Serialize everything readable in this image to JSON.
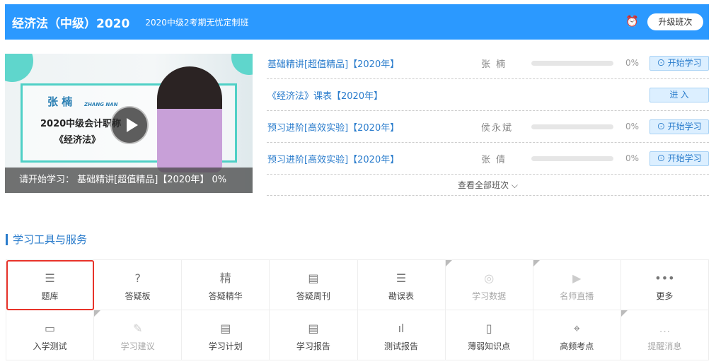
{
  "header": {
    "title": "经济法（中级）2020",
    "subtitle": "2020中级2考期无忧定制班",
    "upgrade_label": "升级班次",
    "alarm_icon": "alarm-clock-icon"
  },
  "video": {
    "teacher_name": "张  楠",
    "teacher_name_en": "ZHANG NAN",
    "line1": "2020中级会计职称",
    "line2": "《经济法》",
    "status": "请开始学习： 基础精讲[超值精品]【2020年】 0%"
  },
  "courses": [
    {
      "title": "基础精讲[超值精品]【2020年】",
      "teacher": "张  楠",
      "progress": 0,
      "pct": "0%",
      "button": "开始学习"
    },
    {
      "title": "《经济法》课表【2020年】",
      "button": "进 入"
    },
    {
      "title": "预习进阶[高效实验]【2020年】",
      "teacher": "侯永斌",
      "progress": 0,
      "pct": "0%",
      "button": "开始学习"
    },
    {
      "title": "预习进阶[高效实验]【2020年】",
      "teacher": "张  倩",
      "progress": 0,
      "pct": "0%",
      "button": "开始学习"
    }
  ],
  "more_label": "查看全部班次 ⌵",
  "tools": {
    "title": "学习工具与服务",
    "items": [
      {
        "label": "题库",
        "icon": "☰"
      },
      {
        "label": "答疑板",
        "icon": "?"
      },
      {
        "label": "答疑精华",
        "icon": "精"
      },
      {
        "label": "答疑周刊",
        "icon": "▤"
      },
      {
        "label": "勘误表",
        "icon": "☰"
      },
      {
        "label": "学习数据",
        "icon": "◎"
      },
      {
        "label": "名师直播",
        "icon": "▶"
      },
      {
        "label": "更多",
        "icon": "•••"
      },
      {
        "label": "入学测试",
        "icon": "▭"
      },
      {
        "label": "学习建议",
        "icon": "✎"
      },
      {
        "label": "学习计划",
        "icon": "▤"
      },
      {
        "label": "学习报告",
        "icon": "▤"
      },
      {
        "label": "测试报告",
        "icon": "ıl"
      },
      {
        "label": "薄弱知识点",
        "icon": "▯"
      },
      {
        "label": "高频考点",
        "icon": "⌖"
      },
      {
        "label": "提醒消息",
        "icon": "…"
      }
    ]
  }
}
